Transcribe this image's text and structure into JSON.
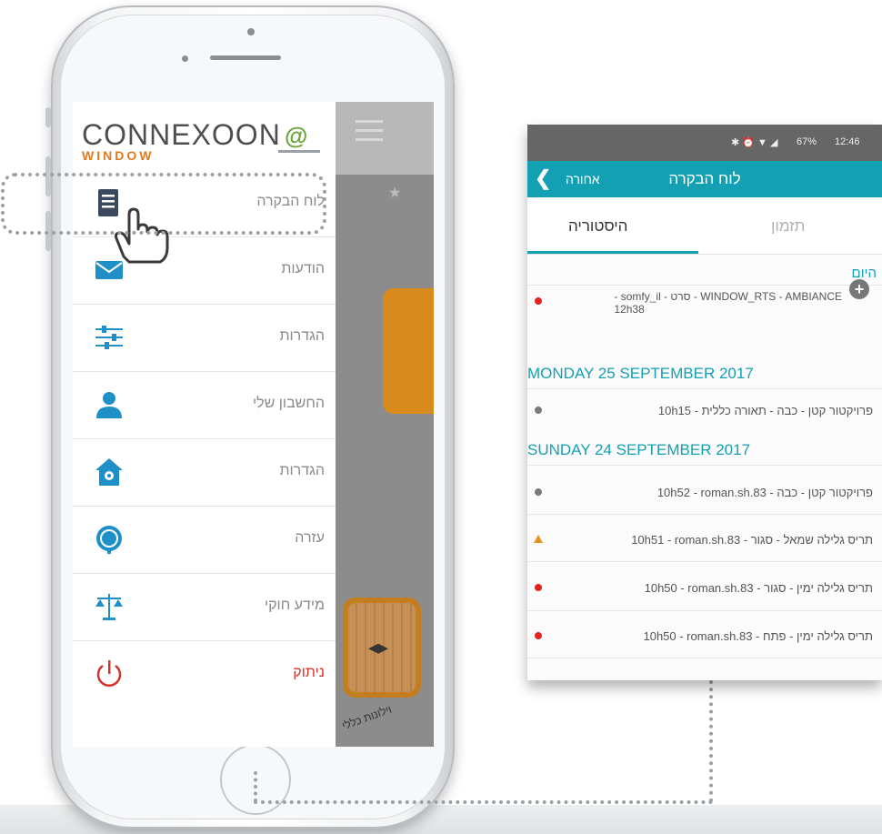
{
  "drawer": {
    "logo": {
      "main": "CONNEXOON",
      "sub": "WINDOW",
      "at_symbol": "@"
    },
    "menu": [
      {
        "label": "לוח הבקרה",
        "icon": "dashboard-icon",
        "color": "#3a4a5c"
      },
      {
        "label": "הודעות",
        "icon": "mail-icon",
        "color": "#1f8fc7"
      },
      {
        "label": "הגדרות",
        "icon": "sliders-icon",
        "color": "#1f8fc7"
      },
      {
        "label": "החשבון שלי",
        "icon": "user-icon",
        "color": "#1f8fc7"
      },
      {
        "label": "הגדרות",
        "icon": "home-gear-icon",
        "color": "#1f8fc7"
      },
      {
        "label": "עזרה",
        "icon": "headset-icon",
        "color": "#1f8fc7"
      },
      {
        "label": "מידע חוקי",
        "icon": "scales-icon",
        "color": "#1f8fc7"
      },
      {
        "label": "ניתוק",
        "icon": "power-icon",
        "color": "#d0342c"
      }
    ]
  },
  "background": {
    "tile_label": "וילונות כללי"
  },
  "app": {
    "status": {
      "icons": "✱ ⏰ ▼ ◢",
      "battery": "67%",
      "time": "12:46"
    },
    "appbar": {
      "back_label": "אחורה",
      "title": "לוח הבקרה"
    },
    "tabs": {
      "history": "היסטוריה",
      "schedule": "תזמון"
    },
    "today_label": "היום",
    "today_entry": {
      "line1": "WINDOW_RTS - AMBIANCE - סרט - somfy_il -",
      "line2": "12h38",
      "status": "red"
    },
    "sections": [
      {
        "header": "MONDAY 25 SEPTEMBER 2017",
        "entries": [
          {
            "text": "פרויקטור קטן - כבה - תאורה כללית - 10h15",
            "status": "gray"
          }
        ]
      },
      {
        "header": "SUNDAY 24 SEPTEMBER 2017",
        "entries": [
          {
            "text": "פרויקטור קטן - כבה - 10h52 - roman.sh.83",
            "status": "gray"
          },
          {
            "text": "תריס גלילה שמאל - סגור - 10h51 - roman.sh.83",
            "status": "warning"
          },
          {
            "text": "תריס גלילה ימין - סגור - 10h50 - roman.sh.83",
            "status": "red"
          },
          {
            "text": "תריס גלילה ימין - פתח - 10h50 - roman.sh.83",
            "status": "red"
          }
        ]
      }
    ],
    "colors": {
      "accent": "#13a0b2",
      "red": "#e0231e",
      "gray": "#7a7a7a",
      "warning": "#e8921e"
    }
  }
}
